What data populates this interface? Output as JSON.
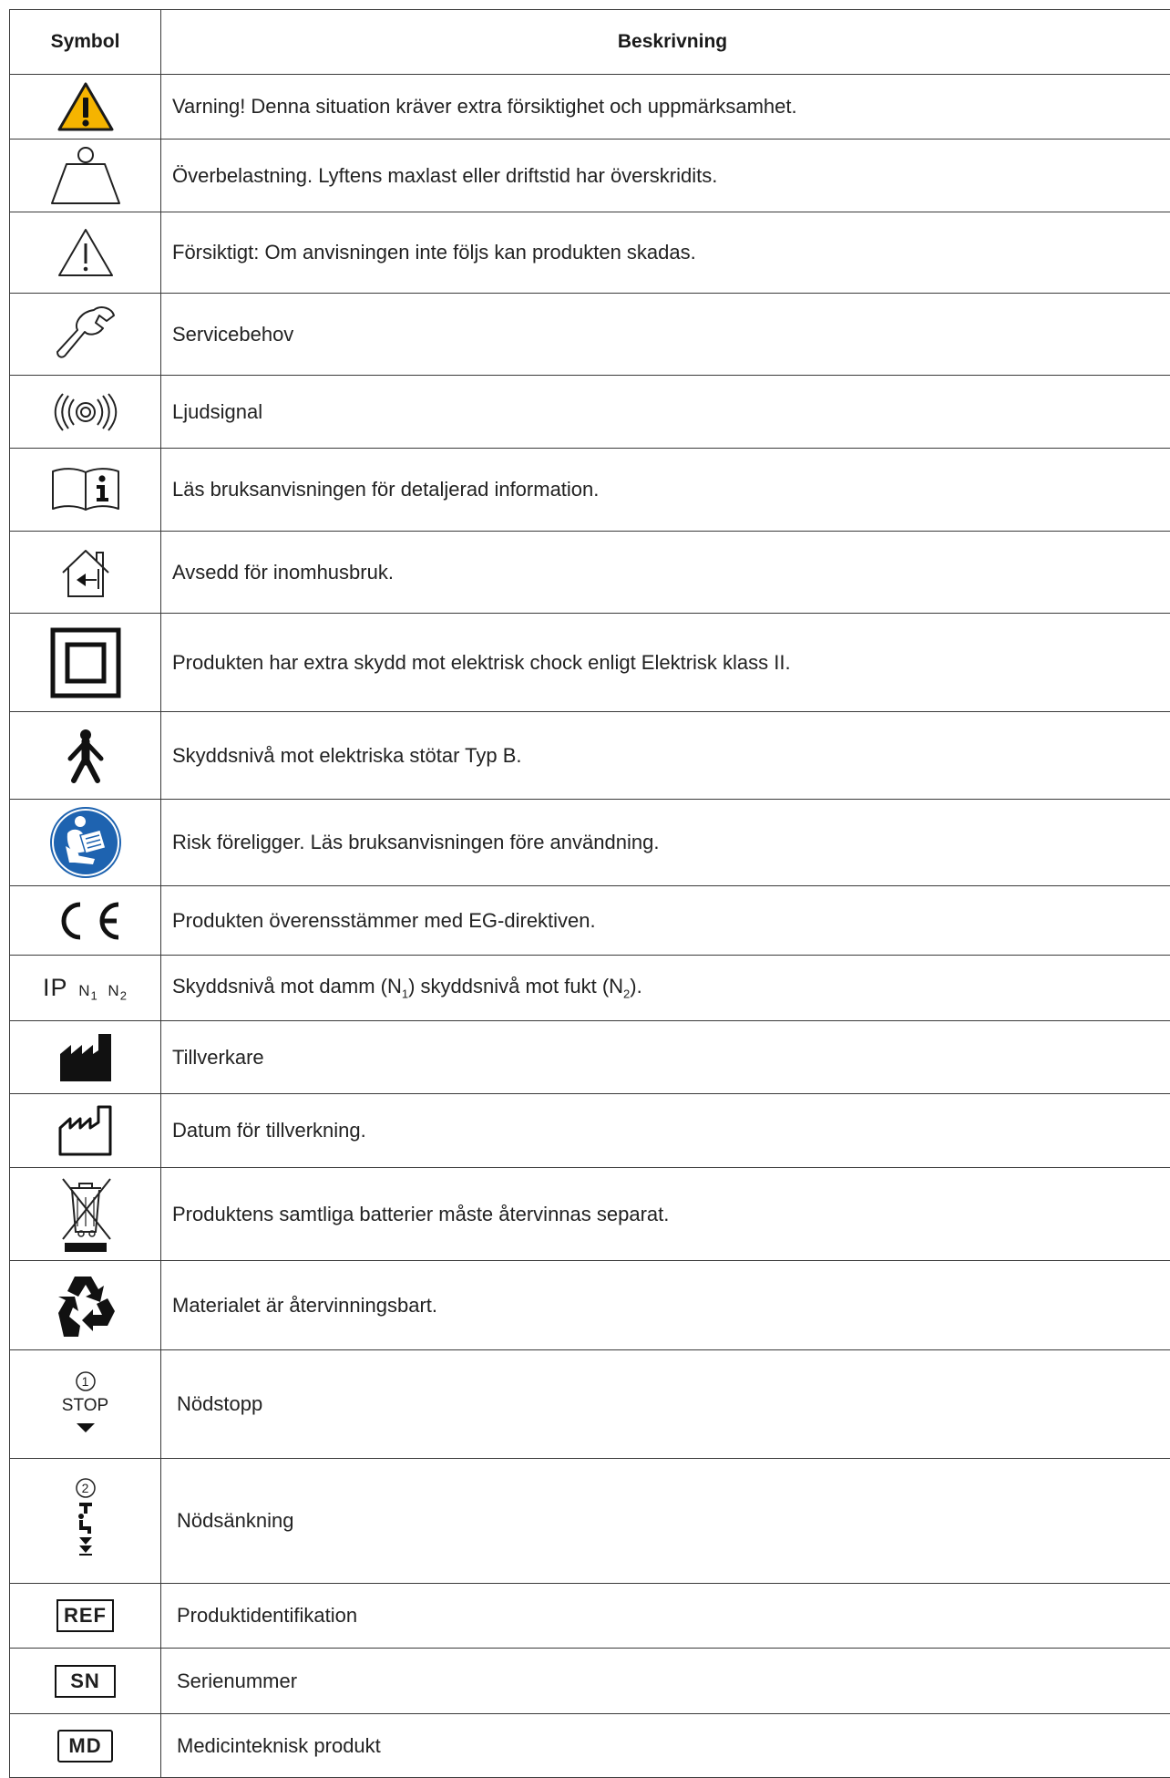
{
  "table": {
    "header": {
      "symbol": "Symbol",
      "description": "Beskrivning"
    },
    "rows": [
      {
        "icon": "warning-yellow-triangle-icon",
        "description": "Varning! Denna situation kräver extra försiktighet och uppmärksamhet."
      },
      {
        "icon": "overload-weight-icon",
        "description": "Överbelastning. Lyftens maxlast eller driftstid har överskridits."
      },
      {
        "icon": "caution-triangle-icon",
        "description": "Försiktigt: Om anvisningen inte följs kan produkten skadas."
      },
      {
        "icon": "wrench-icon",
        "description": "Servicebehov"
      },
      {
        "icon": "sound-signal-icon",
        "description": "Ljudsignal"
      },
      {
        "icon": "manual-info-icon",
        "description": "Läs bruksanvisningen för detaljerad information."
      },
      {
        "icon": "indoor-use-icon",
        "description": "Avsedd för inomhusbruk."
      },
      {
        "icon": "class-ii-icon",
        "description": "Produkten har extra skydd mot elektrisk chock enligt Elektrisk klass II."
      },
      {
        "icon": "type-b-person-icon",
        "description": "Skyddsnivå mot elektriska stötar Typ B."
      },
      {
        "icon": "read-manual-blue-icon",
        "description": "Risk föreligger. Läs bruksanvisningen före användning."
      },
      {
        "icon": "ce-mark-icon",
        "description": "Produkten överensstämmer med EG-direktiven."
      },
      {
        "icon": "ip-rating-icon",
        "description_parts": {
          "a": "Skyddsnivå mot damm (N",
          "sub1": "1",
          "b": ") skyddsnivå mot fukt (N",
          "sub2": "2",
          "c": ")."
        }
      },
      {
        "icon": "manufacturer-icon",
        "description": "Tillverkare"
      },
      {
        "icon": "manufacture-date-icon",
        "description": "Datum för tillverkning."
      },
      {
        "icon": "weee-battery-icon",
        "description": "Produktens samtliga batterier måste återvinnas separat."
      },
      {
        "icon": "recycle-icon",
        "description": "Materialet är återvinningsbart."
      },
      {
        "icon": "emergency-stop-icon",
        "description": "Nödstopp"
      },
      {
        "icon": "emergency-lowering-icon",
        "description": "Nödsänkning"
      },
      {
        "icon": "ref-icon",
        "description": "Produktidentifikation"
      },
      {
        "icon": "sn-icon",
        "description": "Serienummer"
      },
      {
        "icon": "md-icon",
        "description": "Medicinteknisk produkt"
      }
    ]
  },
  "symbols": {
    "ip": {
      "main": "IP",
      "n": "N",
      "s1": "1",
      "s2": "2"
    },
    "stop": {
      "num": "1",
      "label": "STOP"
    },
    "lowering": {
      "num": "2"
    },
    "ref": "REF",
    "sn": "SN",
    "md": "MD"
  },
  "colors": {
    "warning_yellow": "#F5B400",
    "mandatory_blue": "#1E63B0",
    "border": "#3a3a3a"
  }
}
